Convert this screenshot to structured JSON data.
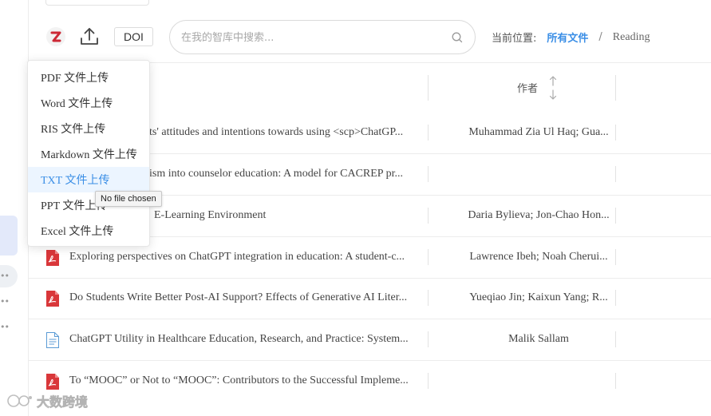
{
  "colors": {
    "accent": "#3a8ee6",
    "pdf_red": "#d9373a",
    "highlight_bg": "#ecf5ff",
    "zotero_red": "#cc2936"
  },
  "toolbar": {
    "zotero_icon": "zotero-z-icon",
    "upload_icon": "upload-icon",
    "doi_label": "DOI"
  },
  "search": {
    "placeholder": "在我的智库中搜索...",
    "value": "",
    "icon": "search-icon"
  },
  "breadcrumb": {
    "label": "当前位置:",
    "root": "所有文件",
    "separator": "/",
    "current": "Reading"
  },
  "table": {
    "columns": {
      "author": "作者"
    },
    "rows": [
      {
        "icon": "",
        "title": "ts' attitudes and intentions towards using <scp>ChatGP...",
        "author": "Muhammad Zia Ul Haq; Gua..."
      },
      {
        "icon": "",
        "title": "ism into counselor education: A model for CACREP pr...",
        "author": ""
      },
      {
        "icon": "",
        "title": "E-Learning Environment",
        "author": "Daria Bylieva; Jon-Chao Hon..."
      },
      {
        "icon": "pdf-icon",
        "title": "Exploring perspectives on ChatGPT integration in education: A student-c...",
        "author": "Lawrence Ibeh; Noah Cherui..."
      },
      {
        "icon": "pdf-icon",
        "title": "Do Students Write Better Post-AI Support? Effects of Generative AI Liter...",
        "author": "Yueqiao Jin; Kaixun Yang; R..."
      },
      {
        "icon": "document-icon",
        "title": "ChatGPT Utility in Healthcare Education, Research, and Practice: System...",
        "author": "Malik Sallam"
      },
      {
        "icon": "pdf-icon",
        "title": "To “MOOC” or Not to “MOOC”: Contributors to the Successful Impleme...",
        "author": ""
      }
    ]
  },
  "upload_menu": {
    "items": [
      {
        "label": "PDF 文件上传"
      },
      {
        "label": "Word 文件上传"
      },
      {
        "label": "RIS 文件上传"
      },
      {
        "label": "Markdown 文件上传"
      },
      {
        "label": "TXT 文件上传"
      },
      {
        "label": "PPT 文件上传"
      },
      {
        "label": "Excel 文件上传"
      }
    ],
    "highlighted_index": 4
  },
  "tooltip": {
    "text": "No file chosen"
  },
  "watermark": {
    "text": "大数跨境"
  }
}
